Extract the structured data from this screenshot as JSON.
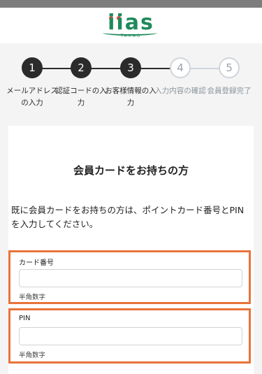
{
  "header": {
    "logo_text": "iias",
    "logo_sub": "TAKAO"
  },
  "steps": [
    {
      "number": "1",
      "label": "メールアドレスの入力",
      "state": "done"
    },
    {
      "number": "2",
      "label": "認証コードの入力",
      "state": "done"
    },
    {
      "number": "3",
      "label": "お客様情報の入力",
      "state": "current"
    },
    {
      "number": "4",
      "label": "入力内容の確認",
      "state": "todo"
    },
    {
      "number": "5",
      "label": "会員登録完了",
      "state": "todo"
    }
  ],
  "main": {
    "title": "会員カードをお持ちの方",
    "description": "既に会員カードをお持ちの方は、ポイントカード番号とPINを入力してください。",
    "card_number": {
      "label": "カード番号",
      "value": "",
      "placeholder": "",
      "hint": "半角数字"
    },
    "pin": {
      "label": "PIN",
      "value": "",
      "placeholder": "",
      "hint": "半角数字"
    }
  },
  "colors": {
    "accent": "#e8743b",
    "step_done": "#2b2b2b",
    "step_todo": "#cfd5dc",
    "brand": "#1f8a5b",
    "brand_dot": "#e24a3b"
  }
}
